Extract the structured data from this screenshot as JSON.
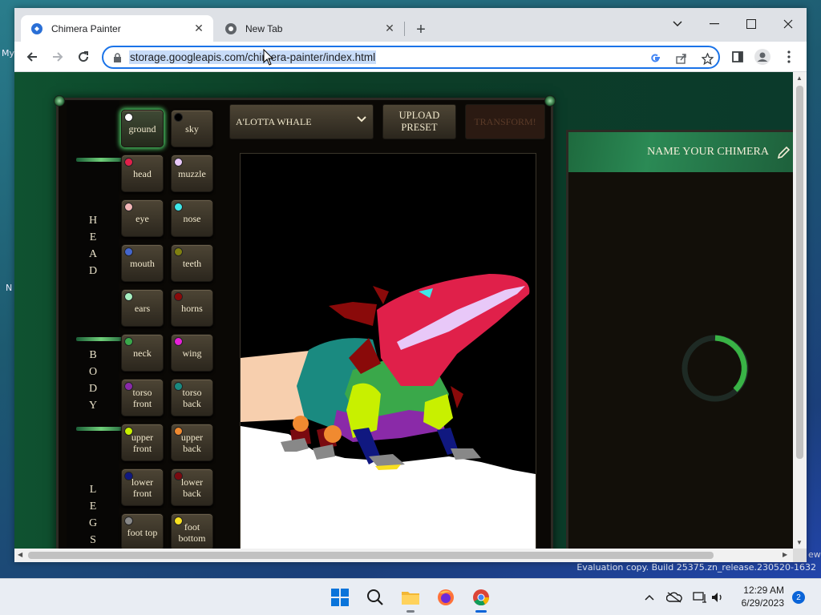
{
  "desktop": {
    "fragments": [
      "My",
      "N"
    ],
    "watermark": "Evaluation copy. Build 25375.zn_release.230520-1632",
    "watermark_tail": "ew"
  },
  "browser": {
    "tabs": [
      {
        "title": "Chimera Painter",
        "icon": "chimera-favicon",
        "active": true
      },
      {
        "title": "New Tab",
        "icon": "chrome-icon",
        "active": false
      }
    ],
    "url": "storage.googleapis.com/chimera-painter/index.html"
  },
  "app": {
    "section_labels": [
      "HEAD",
      "BODY",
      "LEGS"
    ],
    "parts": [
      {
        "label": "ground",
        "color": "#ffffff",
        "selected": true
      },
      {
        "label": "sky",
        "color": "#000000",
        "selected": false
      },
      {
        "label": "head",
        "color": "#e0204a",
        "selected": false
      },
      {
        "label": "muzzle",
        "color": "#e8c8f8",
        "selected": false
      },
      {
        "label": "eye",
        "color": "#f4b6b6",
        "selected": false
      },
      {
        "label": "nose",
        "color": "#3fe8e8",
        "selected": false
      },
      {
        "label": "mouth",
        "color": "#4466cc",
        "selected": false
      },
      {
        "label": "teeth",
        "color": "#808010",
        "selected": false
      },
      {
        "label": "ears",
        "color": "#a8f0c0",
        "selected": false
      },
      {
        "label": "horns",
        "color": "#8a0a0a",
        "selected": false
      },
      {
        "label": "neck",
        "color": "#3aa84a",
        "selected": false
      },
      {
        "label": "wing",
        "color": "#e820d8",
        "selected": false
      },
      {
        "label": "torso front",
        "color": "#8a2aa8",
        "selected": false
      },
      {
        "label": "torso back",
        "color": "#1a8a80",
        "selected": false
      },
      {
        "label": "upper front",
        "color": "#c8f000",
        "selected": false
      },
      {
        "label": "upper back",
        "color": "#f08a30",
        "selected": false
      },
      {
        "label": "lower front",
        "color": "#101880",
        "selected": false
      },
      {
        "label": "lower back",
        "color": "#7a0a10",
        "selected": false
      },
      {
        "label": "foot top",
        "color": "#888888",
        "selected": false
      },
      {
        "label": "foot bottom",
        "color": "#f8e020",
        "selected": false
      }
    ],
    "preset": "A'LOTTA WHALE",
    "upload_label": "UPLOAD PRESET",
    "transform_label": "TRANSFORM!",
    "name_label": "NAME YOUR CHIMERA"
  },
  "taskbar": {
    "time": "12:29 AM",
    "date": "6/29/2023",
    "notifications": "2"
  },
  "colors": {
    "accent": "#1a73e8",
    "glow": "#4fd36a"
  }
}
